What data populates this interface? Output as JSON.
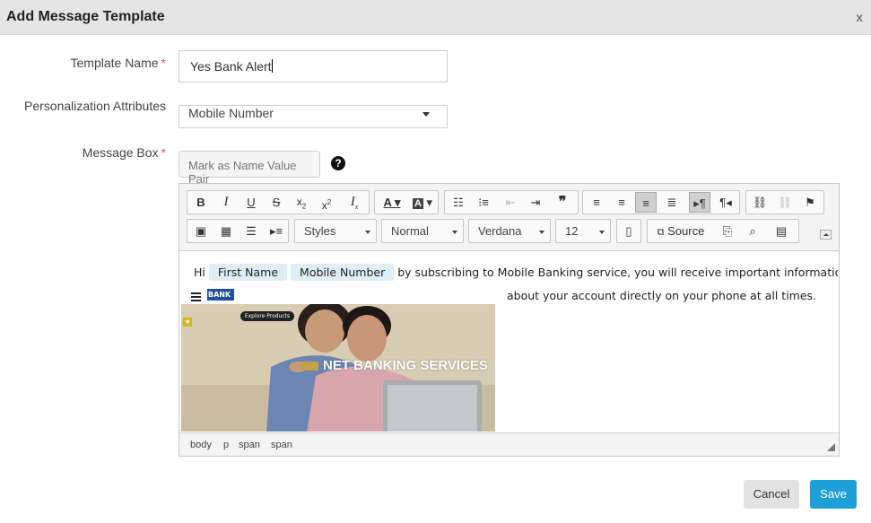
{
  "dialog": {
    "title": "Add Message Template",
    "close_label": "x"
  },
  "form": {
    "template_name": {
      "label": "Template Name",
      "required_mark": "*",
      "value": "Yes Bank Alert"
    },
    "personalization": {
      "label": "Personalization Attributes",
      "selected": "Mobile Number"
    },
    "message_box": {
      "label": "Message Box",
      "required_mark": "*",
      "mark_button": "Mark as Name Value Pair",
      "help": "?"
    }
  },
  "editor": {
    "toolbar_row1": [
      "bold-icon",
      "italic-icon",
      "underline-icon",
      "strikethrough-icon",
      "subscript-icon",
      "superscript-icon",
      "remove-format-icon",
      "text-color-icon",
      "background-color-icon",
      "numbered-list-icon",
      "bulleted-list-icon",
      "decrease-indent-icon",
      "increase-indent-icon",
      "blockquote-icon",
      "align-left-icon",
      "align-center-icon",
      "align-right-icon",
      "justify-icon",
      "ltr-icon",
      "rtl-icon",
      "link-icon",
      "unlink-icon",
      "anchor-icon"
    ],
    "toolbar_row2": {
      "styles": "Styles",
      "format": "Normal",
      "font": "Verdana",
      "size": "12",
      "source": "Source"
    },
    "content": {
      "greeting": "Hi",
      "chip_first_name": "First Name",
      "chip_mobile_number": "Mobile Number",
      "line1_text": "by subscribing to Mobile Banking service, you will receive important information",
      "line2_text": "about your account directly on your phone at all times.",
      "logo_text": "BANK",
      "banner_pill": "Explore Products",
      "banner_headline": "NET BANKING SERVICES"
    },
    "path": [
      "body",
      "p",
      "span",
      "span"
    ]
  },
  "actions": {
    "cancel": "Cancel",
    "save": "Save"
  },
  "colors": {
    "accent": "#1e9fd8",
    "required": "#d9534f",
    "chip": "#e0eef8"
  }
}
